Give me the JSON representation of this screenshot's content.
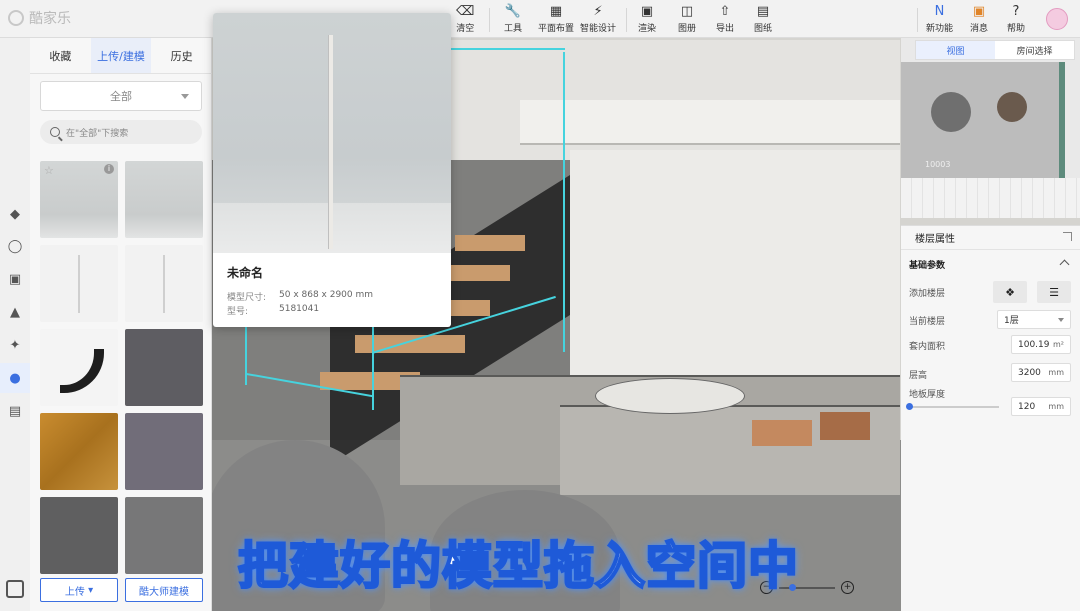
{
  "app": {
    "name": "酷家乐"
  },
  "toolbar": {
    "items": [
      {
        "label": "清空",
        "icon": "eraser-icon"
      },
      {
        "label": "工具",
        "icon": "wrench-icon"
      },
      {
        "label": "平面布置",
        "icon": "floorplan-icon"
      },
      {
        "label": "智能设计",
        "icon": "lightning-icon"
      },
      {
        "label": "渲染",
        "icon": "render-icon"
      },
      {
        "label": "图册",
        "icon": "album-icon"
      },
      {
        "label": "导出",
        "icon": "export-icon"
      },
      {
        "label": "图纸",
        "icon": "drawing-icon"
      }
    ],
    "right_items": [
      {
        "label": "新功能",
        "icon": "new-feature-icon"
      },
      {
        "label": "消息",
        "icon": "gift-icon"
      },
      {
        "label": "帮助",
        "icon": "help-icon"
      }
    ]
  },
  "left_panel": {
    "tabs": [
      "收藏",
      "上传/建模",
      "历史"
    ],
    "active_tab": "上传/建模",
    "filter": {
      "selected": "全部"
    },
    "search": {
      "placeholder": "在\"全部\"下搜索"
    },
    "upload_button": "上传",
    "master_button": "酷大师建模"
  },
  "preview": {
    "name": "未命名",
    "size_label": "模型尺寸:",
    "size_value": "50 x 868 x 2900 mm",
    "model_label": "型号:",
    "model_value": "5181041"
  },
  "minimap": {
    "tabs": [
      "视图",
      "房间选择"
    ],
    "active_tab": "视图",
    "room_label": "10003"
  },
  "properties": {
    "title": "楼层属性",
    "section": "基础参数",
    "add_floor_label": "添加楼层",
    "current_floor_label": "当前楼层",
    "current_floor_value": "1层",
    "area_label": "套内面积",
    "area_value": "100.19",
    "area_unit": "m²",
    "height_label": "层高",
    "height_value": "3200",
    "height_unit": "mm",
    "thickness_label": "地板厚度",
    "thickness_value": "120",
    "thickness_unit": "mm"
  },
  "caption": "把建好的模型拖入空间中",
  "colors": {
    "accent": "#3b6fe0",
    "caption_stroke": "#1e5ad8",
    "bbox": "#46d3de"
  }
}
